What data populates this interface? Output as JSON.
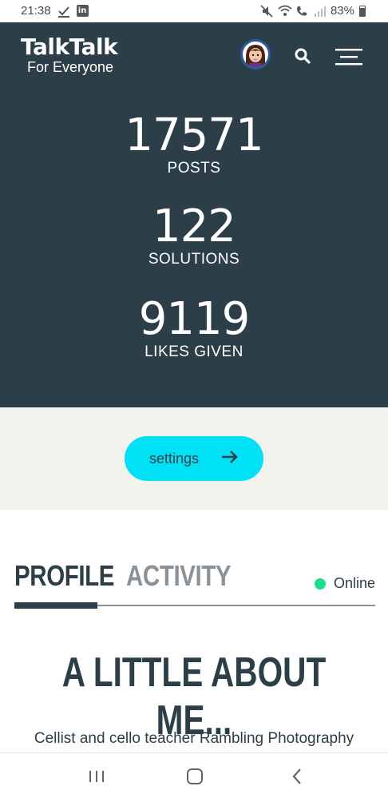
{
  "status_bar": {
    "time": "21:38",
    "battery": "83%",
    "left_icons": [
      "checkmark-download-icon",
      "linkedin-icon"
    ],
    "right_icons": [
      "mute-icon",
      "wifi-icon",
      "wifi-calling-icon",
      "signal-icon",
      "battery-icon"
    ]
  },
  "header": {
    "brand": "TalkTalk",
    "tagline": "For Everyone",
    "background": "#2c3e47"
  },
  "stats": [
    {
      "value": "17571",
      "label": "POSTS"
    },
    {
      "value": "122",
      "label": "SOLUTIONS"
    },
    {
      "value": "9119",
      "label": "LIKES GIVEN"
    }
  ],
  "settings": {
    "label": "settings",
    "color": "#00e1f5"
  },
  "tabs": {
    "profile": "PROFILE",
    "activity": "ACTIVITY",
    "active": "PROFILE"
  },
  "presence": {
    "status": "Online",
    "color": "#18e08a"
  },
  "about": {
    "title": "A LITTLE ABOUT ME...",
    "text": "Cellist and cello teacher Rambling Photography"
  },
  "nav": {
    "buttons": [
      "recent-apps-icon",
      "home-icon",
      "back-icon"
    ]
  }
}
